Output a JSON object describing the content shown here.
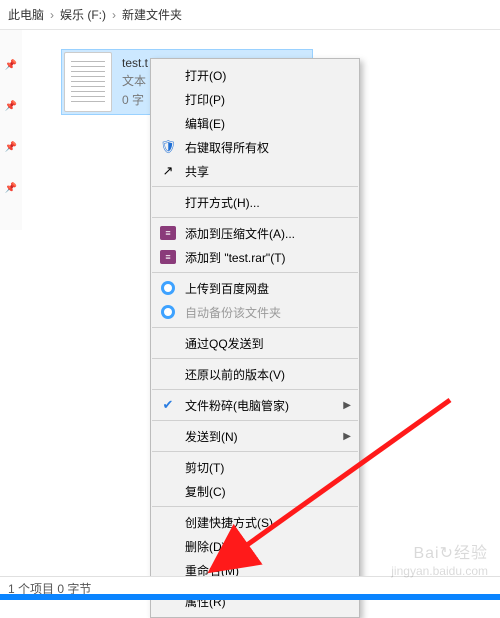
{
  "breadcrumb": {
    "a": "此电脑",
    "b": "娱乐 (F:)",
    "c": "新建文件夹"
  },
  "file": {
    "name": "test.t",
    "type": "文本",
    "size": "0 字"
  },
  "menu": {
    "open": "打开(O)",
    "print": "打印(P)",
    "edit": "编辑(E)",
    "takeowner": "右键取得所有权",
    "share": "共享",
    "openwith": "打开方式(H)...",
    "addarchive": "添加到压缩文件(A)...",
    "addtestrar": "添加到 \"test.rar\"(T)",
    "baiduupload": "上传到百度网盘",
    "baidubackup": "自动备份该文件夹",
    "qqsend": "通过QQ发送到",
    "restore": "还原以前的版本(V)",
    "shred": "文件粉碎(电脑管家)",
    "sendto": "发送到(N)",
    "cut": "剪切(T)",
    "copy": "复制(C)",
    "shortcut": "创建快捷方式(S)",
    "delete": "删除(D)",
    "rename": "重命名(M)",
    "properties": "属性(R)"
  },
  "status": "1 个项目   0 字节",
  "watermark": {
    "line1": "Bai↻经验",
    "line2": "jingyan.baidu.com"
  }
}
